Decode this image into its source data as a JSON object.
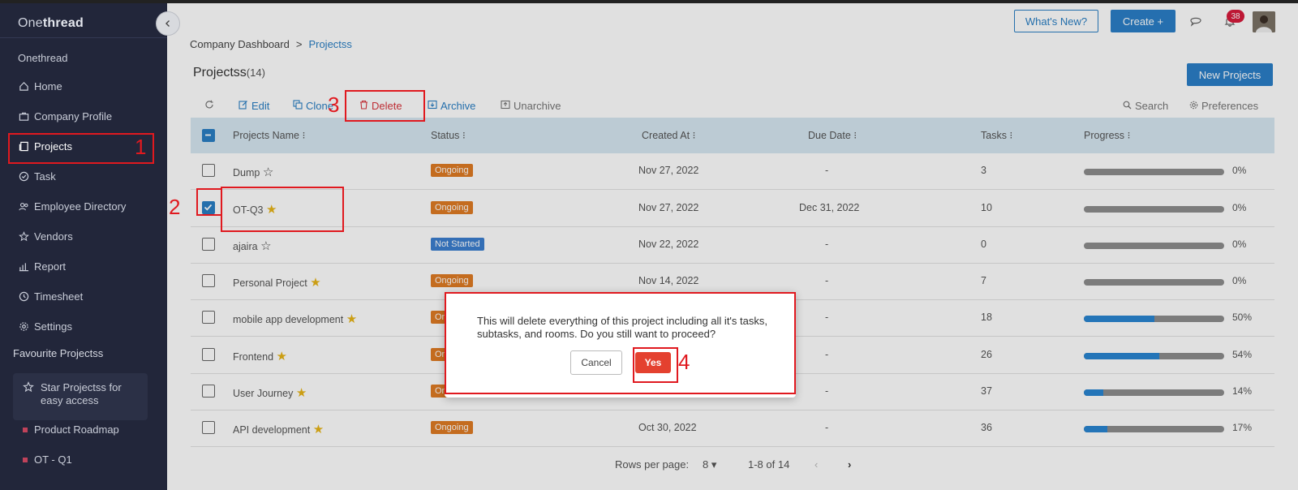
{
  "app": {
    "brand_light": "One",
    "brand_bold": "thread"
  },
  "sidebar": {
    "workspace": "Onethread",
    "items": [
      {
        "label": "Home",
        "icon": "home-icon"
      },
      {
        "label": "Company Profile",
        "icon": "briefcase-icon"
      },
      {
        "label": "Projects",
        "icon": "projects-icon"
      },
      {
        "label": "Task",
        "icon": "check-circle-icon"
      },
      {
        "label": "Employee Directory",
        "icon": "people-icon"
      },
      {
        "label": "Vendors",
        "icon": "star-icon"
      },
      {
        "label": "Report",
        "icon": "bar-chart-icon"
      },
      {
        "label": "Timesheet",
        "icon": "clock-icon"
      },
      {
        "label": "Settings",
        "icon": "gear-icon"
      }
    ],
    "favourites_label": "Favourite Projectss",
    "star_hint": "Star Projectss for easy access",
    "favourites": [
      "Product Roadmap",
      "OT - Q1"
    ]
  },
  "topbar": {
    "whats_new": "What's New?",
    "create": "Create +",
    "notification_count": "38"
  },
  "breadcrumb": {
    "root": "Company Dashboard",
    "sep": ">",
    "current": "Projectss"
  },
  "page": {
    "title": "Projectss",
    "count": "(14)",
    "new_button": "New Projects"
  },
  "toolbar": {
    "edit": "Edit",
    "clone": "Clone",
    "delete": "Delete",
    "archive": "Archive",
    "unarchive": "Unarchive",
    "search": "Search",
    "preferences": "Preferences"
  },
  "table": {
    "columns": [
      "Projects Name",
      "Status",
      "Created At",
      "Due Date",
      "Tasks",
      "Progress"
    ],
    "rows": [
      {
        "name": "Dump",
        "starred": false,
        "status": "Ongoing",
        "created": "Nov 27, 2022",
        "due": "-",
        "tasks": "3",
        "progress": "0%",
        "checked": false
      },
      {
        "name": "OT-Q3",
        "starred": true,
        "status": "Ongoing",
        "created": "Nov 27, 2022",
        "due": "Dec 31, 2022",
        "tasks": "10",
        "progress": "0%",
        "checked": true
      },
      {
        "name": "ajaira",
        "starred": false,
        "status": "Not Started",
        "created": "Nov 22, 2022",
        "due": "-",
        "tasks": "0",
        "progress": "0%",
        "checked": false
      },
      {
        "name": "Personal Project",
        "starred": true,
        "status": "Ongoing",
        "created": "Nov 14, 2022",
        "due": "-",
        "tasks": "7",
        "progress": "0%",
        "checked": false
      },
      {
        "name": "mobile app development",
        "starred": true,
        "status": "Ongoing",
        "created": "",
        "due": "-",
        "tasks": "18",
        "progress": "50%",
        "checked": false
      },
      {
        "name": "Frontend",
        "starred": true,
        "status": "Ongoing",
        "created": "",
        "due": "-",
        "tasks": "26",
        "progress": "54%",
        "checked": false
      },
      {
        "name": "User Journey",
        "starred": true,
        "status": "Ongoing",
        "created": "",
        "due": "-",
        "tasks": "37",
        "progress": "14%",
        "checked": false
      },
      {
        "name": "API development",
        "starred": true,
        "status": "Ongoing",
        "created": "Oct 30, 2022",
        "due": "-",
        "tasks": "36",
        "progress": "17%",
        "checked": false
      }
    ]
  },
  "pagination": {
    "rows_label": "Rows per page:",
    "rows_value": "8",
    "range": "1-8 of 14"
  },
  "dialog": {
    "message": "This will delete everything of this project including all it's tasks, subtasks, and rooms. Do you still want to proceed?",
    "cancel": "Cancel",
    "confirm": "Yes"
  },
  "annotations": [
    "1",
    "2",
    "3",
    "4"
  ],
  "colors": {
    "sidebar_bg": "#22263a",
    "accent": "#2a7fc4",
    "ongoing": "#e07b24",
    "not_started": "#3c7fd0",
    "danger": "#e4412f",
    "annotation": "#e0191f"
  }
}
